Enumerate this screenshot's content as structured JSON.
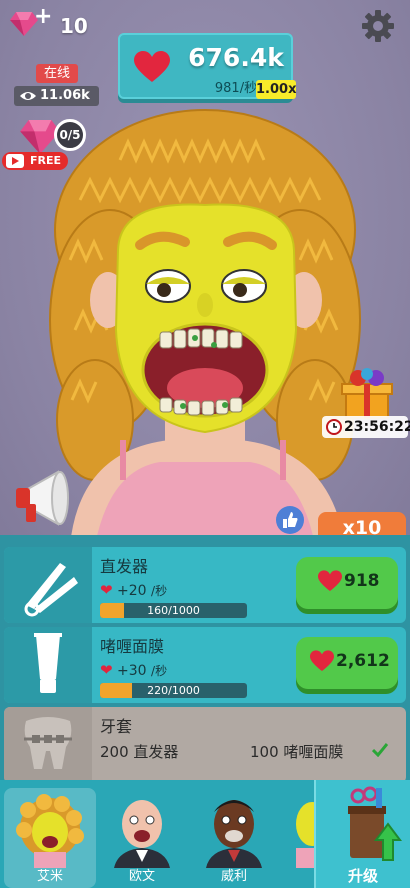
{
  "hud": {
    "gems": "10",
    "gem_icon": "gem-icon",
    "settings_icon": "gear-icon"
  },
  "score": {
    "hearts": "676.4k",
    "per_second": "981/秒",
    "multiplier": "1.00x"
  },
  "live": {
    "status": "在线",
    "viewers": "11.06k"
  },
  "gem_offer": {
    "progress": "0/5",
    "free_label": "FREE"
  },
  "gift": {
    "timer": "23:56:22"
  },
  "boost": {
    "label": "x10"
  },
  "upgrades": [
    {
      "name": "直发器",
      "icon": "hair-straightener-icon",
      "rate": "+20",
      "rate_unit": "/秒",
      "progress_text": "160/1000",
      "progress": 0.16,
      "cost": "918"
    },
    {
      "name": "啫喱面膜",
      "icon": "face-mask-tube-icon",
      "rate": "+30",
      "rate_unit": "/秒",
      "progress_text": "220/1000",
      "progress": 0.22,
      "cost": "2,612"
    },
    {
      "name": "牙套",
      "icon": "braces-icon",
      "requirement_1": "200 直发器",
      "requirement_2": "100 啫喱面膜"
    }
  ],
  "patients": [
    {
      "name": "艾米",
      "selected": true
    },
    {
      "name": "欧文",
      "selected": false
    },
    {
      "name": "威利",
      "selected": false
    }
  ],
  "upgrade_button": {
    "label": "升级"
  },
  "colors": {
    "heart": "#e2263e",
    "panel": "#37b8c5",
    "buy_button": "#52c94a",
    "locked_card": "#b1a9a3",
    "boost": "#f07c3a"
  }
}
